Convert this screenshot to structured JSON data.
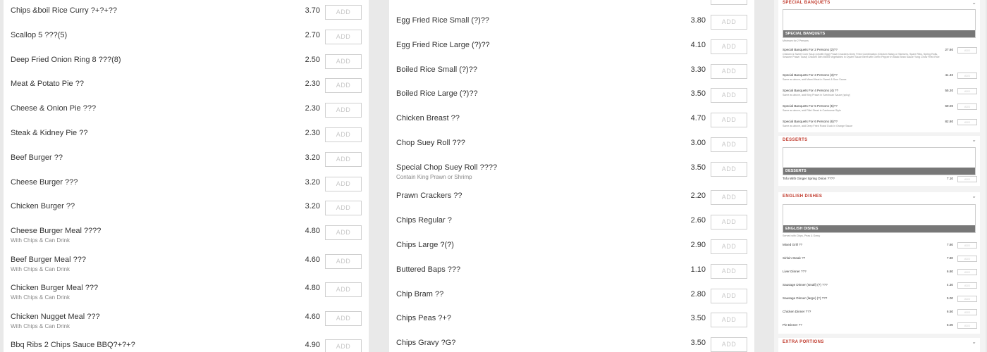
{
  "add_label": "ADD",
  "column1": [
    {
      "name": "Chips &boil Rice Curry ?+?+??",
      "price": "3.70",
      "desc": ""
    },
    {
      "name": "Scallop 5 ???(5)",
      "price": "2.70",
      "desc": ""
    },
    {
      "name": "Deep Fried Onion Ring 8 ???(8)",
      "price": "2.50",
      "desc": ""
    },
    {
      "name": "Meat & Potato Pie ??",
      "price": "2.30",
      "desc": ""
    },
    {
      "name": "Cheese & Onion Pie ???",
      "price": "2.30",
      "desc": ""
    },
    {
      "name": "Steak & Kidney Pie ??",
      "price": "2.30",
      "desc": ""
    },
    {
      "name": "Beef Burger ??",
      "price": "3.20",
      "desc": ""
    },
    {
      "name": "Cheese Burger ???",
      "price": "3.20",
      "desc": ""
    },
    {
      "name": "Chicken Burger ??",
      "price": "3.20",
      "desc": ""
    },
    {
      "name": "Cheese Burger Meal ????",
      "price": "4.80",
      "desc": "With Chips & Can Drink"
    },
    {
      "name": "Beef Burger Meal ???",
      "price": "4.60",
      "desc": "With Chips & Can Drink"
    },
    {
      "name": "Chicken Burger Meal ???",
      "price": "4.80",
      "desc": "With Chips & Can Drink"
    },
    {
      "name": "Chicken Nugget Meal ???",
      "price": "4.60",
      "desc": "With Chips & Can Drink"
    },
    {
      "name": "Bbq Ribs 2 Chips Sauce BBQ?+?+?",
      "price": "4.90",
      "desc": ""
    }
  ],
  "column2": [
    {
      "name": "Egg Fried Rice Small (?)??",
      "price": "3.80",
      "desc": ""
    },
    {
      "name": "Egg Fried Rice Large (?)??",
      "price": "4.10",
      "desc": ""
    },
    {
      "name": "Boiled Rice Small (?)??",
      "price": "3.30",
      "desc": ""
    },
    {
      "name": "Boiled Rice Large (?)??",
      "price": "3.50",
      "desc": ""
    },
    {
      "name": "Chicken Breast ??",
      "price": "4.70",
      "desc": ""
    },
    {
      "name": "Chop Suey Roll ???",
      "price": "3.00",
      "desc": ""
    },
    {
      "name": "Special Chop Suey Roll ????",
      "price": "3.50",
      "desc": "Contain King Prawn or Shrimp"
    },
    {
      "name": "Prawn Crackers ??",
      "price": "2.20",
      "desc": ""
    },
    {
      "name": "Chips Regular ?",
      "price": "2.60",
      "desc": ""
    },
    {
      "name": "Chips Large ?(?)",
      "price": "2.90",
      "desc": ""
    },
    {
      "name": "Buttered Baps ???",
      "price": "1.10",
      "desc": ""
    },
    {
      "name": "Chip Bram ??",
      "price": "2.80",
      "desc": ""
    },
    {
      "name": "Chips Peas ?+?",
      "price": "3.50",
      "desc": ""
    },
    {
      "name": "Chips Gravy ?G?",
      "price": "3.50",
      "desc": ""
    }
  ],
  "sidebar": {
    "banquets": {
      "title": "SPECIAL BANQUETS",
      "banner": "SPECIAL BANQUETS",
      "note": "Minimum for 2 Persons",
      "items": [
        {
          "name": "Special Banquets For 2 Persons (2)??",
          "price": "27.60",
          "desc": "Chicken & Sweet Corn Soup (or)with Egg) Prawn Crackers Deep Fried Combination (Chicken Satay or Skewers, Spare Ribs, Spring Rolls, Sesame Prawn Toast) Chicken with Mixed Vegetables in Oyster Sauce Beef with Green Pepper in Black Bean Sauce Yung Chow Fried Rice"
        },
        {
          "name": "Special Banquets For 3 Persons (3)??",
          "price": "41.40",
          "desc": "Same as above, add Mixed Meat in Sweet & Sour Sauce"
        },
        {
          "name": "Special Banquets For 4 Persons (4) ??",
          "price": "55.20",
          "desc": "Same as above, add King Prawn in Szechuan Sauce (spicy)"
        },
        {
          "name": "Special Banquets For 5 Persons (5)??",
          "price": "69.00",
          "desc": "Same as above, add Fillet Steak in Cantonese Style"
        },
        {
          "name": "Special Banquets For 6 Persons (6)??",
          "price": "82.80",
          "desc": "Same as above, add Deep Fried Roast Duck in Orange Sauce"
        }
      ]
    },
    "desserts": {
      "title": "DESSERTS",
      "banner": "DESSERTS",
      "items": [
        {
          "name": "Tofu With Ginger Spring Onion ????",
          "price": "7.10"
        }
      ]
    },
    "english": {
      "title": "ENGLISH DISHES",
      "banner": "ENGLISH DISHES",
      "note": "Served with Chips, Peas & Gravy",
      "items": [
        {
          "name": "Mixed Grill ??",
          "price": "7.80"
        },
        {
          "name": "Sirloin Steak ??",
          "price": "7.80"
        },
        {
          "name": "Liver Dinner ???",
          "price": "6.80"
        },
        {
          "name": "Sausage Dinner (small) (?) ???",
          "price": "4.30"
        },
        {
          "name": "Sausage Dinner (large) (?) ???",
          "price": "5.00"
        },
        {
          "name": "Chicken Dinner ???",
          "price": "6.50"
        },
        {
          "name": "Pie Dinner ??",
          "price": "5.00"
        }
      ]
    },
    "extra": {
      "title": "EXTRA PORTIONS"
    }
  }
}
